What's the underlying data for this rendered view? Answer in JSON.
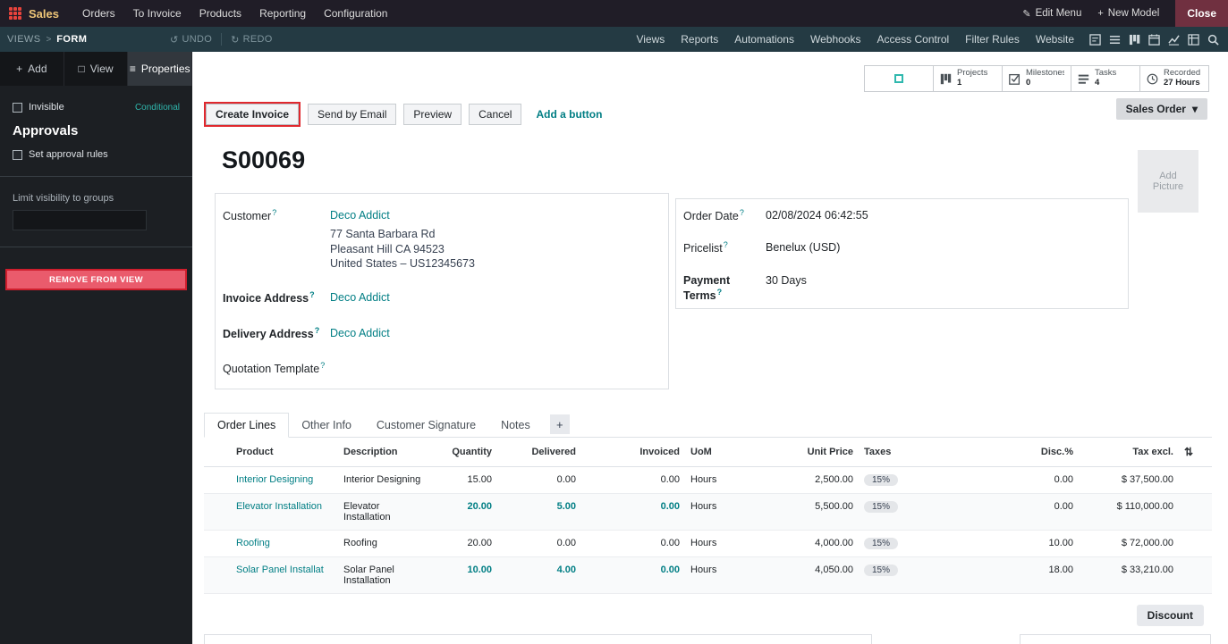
{
  "topbar": {
    "app_name": "Sales",
    "menus": [
      "Orders",
      "To Invoice",
      "Products",
      "Reporting",
      "Configuration"
    ],
    "edit_menu": "Edit Menu",
    "new_model": "New Model",
    "close": "Close"
  },
  "studiobar": {
    "breadcrumb_root": "VIEWS",
    "breadcrumb_current": "FORM",
    "undo": "UNDO",
    "redo": "REDO",
    "menu": [
      "Views",
      "Reports",
      "Automations",
      "Webhooks",
      "Access Control",
      "Filter Rules",
      "Website"
    ]
  },
  "sidebar": {
    "tab_add": "Add",
    "tab_view": "View",
    "tab_properties": "Properties",
    "invisible": "Invisible",
    "conditional": "Conditional",
    "approvals_title": "Approvals",
    "set_approval_rules": "Set approval rules",
    "limit_visibility": "Limit visibility to groups",
    "remove_from_view": "REMOVE FROM VIEW"
  },
  "statbar": {
    "buttons": [
      {
        "label": "Projects",
        "value": "1"
      },
      {
        "label": "Milestones",
        "value": "0"
      },
      {
        "label": "Tasks",
        "value": "4"
      },
      {
        "label": "Recorded",
        "value": "27 Hours"
      }
    ]
  },
  "status": {
    "label": "Sales Order"
  },
  "actions": {
    "create_invoice": "Create Invoice",
    "send_by_email": "Send by Email",
    "preview": "Preview",
    "cancel": "Cancel",
    "add_a_button": "Add a button"
  },
  "record": {
    "title": "S00069",
    "add_picture": "Add Picture",
    "customer_label": "Customer",
    "customer": "Deco Addict",
    "address1": "77 Santa Barbara Rd",
    "address2": "Pleasant Hill CA 94523",
    "address3": "United States – US12345673",
    "invoice_address_label": "Invoice Address",
    "invoice_address": "Deco Addict",
    "delivery_address_label": "Delivery Address",
    "delivery_address": "Deco Addict",
    "quotation_template_label": "Quotation Template",
    "order_date_label": "Order Date",
    "order_date": "02/08/2024 06:42:55",
    "pricelist_label": "Pricelist",
    "pricelist": "Benelux (USD)",
    "payment_terms_label": "Payment Terms",
    "payment_terms": "30 Days"
  },
  "notebook": {
    "tabs": [
      "Order Lines",
      "Other Info",
      "Customer Signature",
      "Notes"
    ]
  },
  "order_lines": {
    "columns": {
      "product": "Product",
      "description": "Description",
      "quantity": "Quantity",
      "delivered": "Delivered",
      "invoiced": "Invoiced",
      "uom": "UoM",
      "unit_price": "Unit Price",
      "taxes": "Taxes",
      "disc": "Disc.%",
      "tax_excl": "Tax excl."
    },
    "rows": [
      {
        "product": "Interior Designing",
        "description": "Interior Designing",
        "quantity": "15.00",
        "delivered": "0.00",
        "invoiced": "0.00",
        "uom": "Hours",
        "unit_price": "2,500.00",
        "taxes": "15%",
        "disc": "0.00",
        "tax_excl": "$ 37,500.00"
      },
      {
        "product": "Elevator Installation",
        "description": "Elevator Installation",
        "quantity": "20.00",
        "delivered": "5.00",
        "invoiced": "0.00",
        "uom": "Hours",
        "unit_price": "5,500.00",
        "taxes": "15%",
        "disc": "0.00",
        "tax_excl": "$ 110,000.00"
      },
      {
        "product": "Roofing",
        "description": "Roofing",
        "quantity": "20.00",
        "delivered": "0.00",
        "invoiced": "0.00",
        "uom": "Hours",
        "unit_price": "4,000.00",
        "taxes": "15%",
        "disc": "10.00",
        "tax_excl": "$ 72,000.00"
      },
      {
        "product": "Solar Panel Installat",
        "description": "Solar Panel Installation",
        "quantity": "10.00",
        "delivered": "4.00",
        "invoiced": "0.00",
        "uom": "Hours",
        "unit_price": "4,050.00",
        "taxes": "15%",
        "disc": "18.00",
        "tax_excl": "$ 33,210.00"
      }
    ],
    "discount_button": "Discount"
  },
  "icons": {
    "plus": "+",
    "pencil": "✎",
    "chevron": ">",
    "undo": "↺",
    "redo": "↻",
    "caret_down": "▾",
    "square": "□",
    "sliders": "≡",
    "adjust": "⇅",
    "help": "?"
  },
  "colors": {
    "accent_teal": "#017e84",
    "studio_selection_red": "#e0282e",
    "app_name_gold": "#efc678",
    "topbar_bg": "#201d27",
    "studiobar_bg": "#243a43",
    "sidebar_bg": "#1c1f23",
    "remove_button_red": "#ea5b6c"
  }
}
